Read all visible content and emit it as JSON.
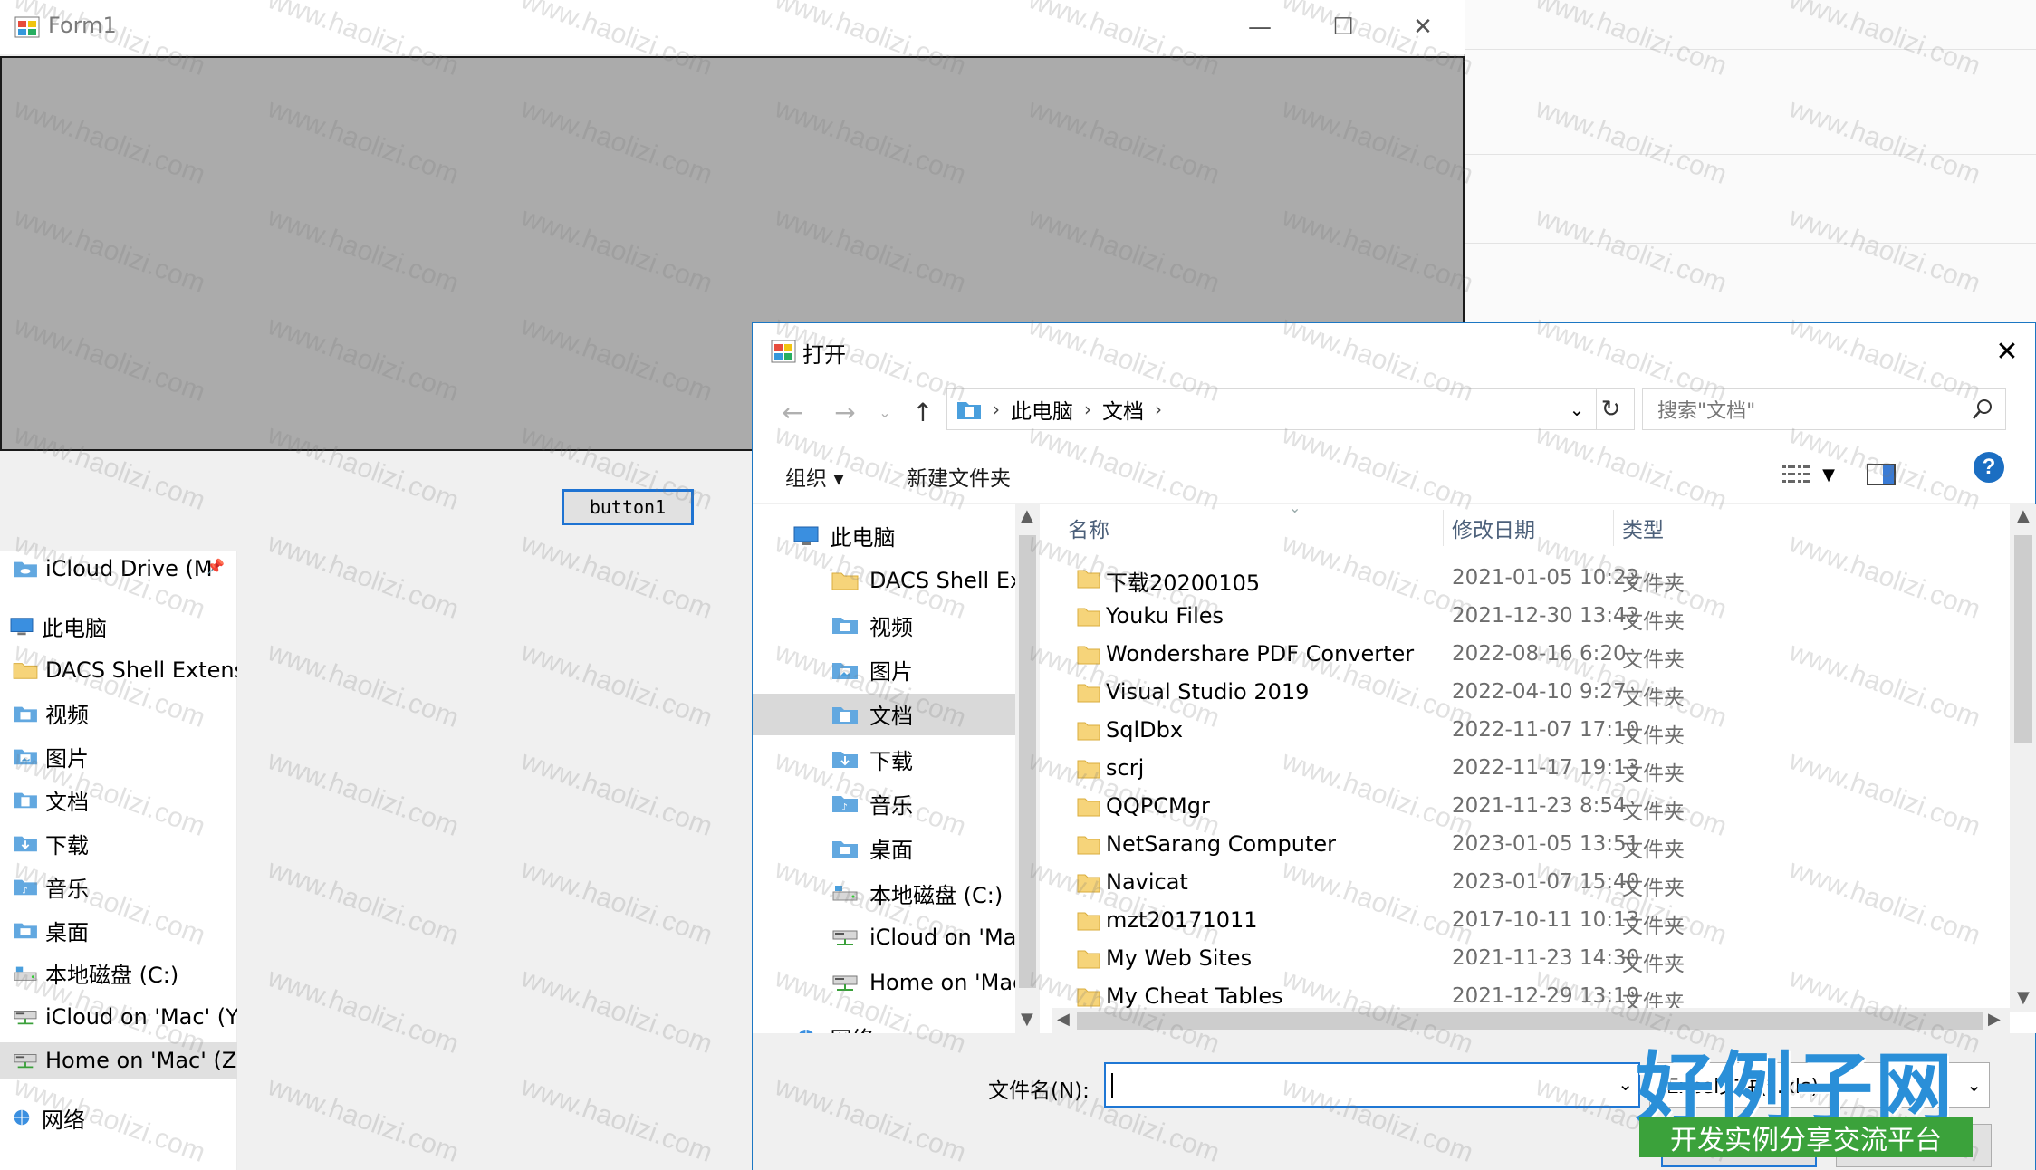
{
  "form1": {
    "title": "Form1",
    "button_label": "button1",
    "caption_buttons": {
      "minimize": "—",
      "maximize": "☐",
      "close": "✕"
    }
  },
  "background_nav": {
    "items": [
      {
        "label": "iCloud Drive (M",
        "icon": "cloud-folder-icon"
      },
      {
        "label": "此电脑",
        "icon": "computer-icon"
      },
      {
        "label": "DACS Shell Extensi",
        "icon": "folder-icon"
      },
      {
        "label": "视频",
        "icon": "video-folder-icon"
      },
      {
        "label": "图片",
        "icon": "pictures-folder-icon"
      },
      {
        "label": "文档",
        "icon": "documents-folder-icon"
      },
      {
        "label": "下载",
        "icon": "downloads-folder-icon"
      },
      {
        "label": "音乐",
        "icon": "music-folder-icon"
      },
      {
        "label": "桌面",
        "icon": "desktop-folder-icon"
      },
      {
        "label": "本地磁盘 (C:)",
        "icon": "drive-icon"
      },
      {
        "label": "iCloud on 'Mac' (Y:",
        "icon": "network-drive-icon"
      },
      {
        "label": "Home on 'Mac' (Z:",
        "icon": "network-drive-icon"
      },
      {
        "label": "网络",
        "icon": "network-icon"
      }
    ]
  },
  "dialog": {
    "title": "打开",
    "close": "✕",
    "breadcrumb": [
      "此电脑",
      "文档"
    ],
    "search_placeholder": "搜索\"文档\"",
    "organize": "组织 ▾",
    "new_folder": "新建文件夹",
    "help": "?",
    "nav_items": [
      {
        "label": "此电脑",
        "icon": "computer-icon"
      },
      {
        "label": "DACS Shell Exte",
        "icon": "folder-icon"
      },
      {
        "label": "视频",
        "icon": "video-folder-icon"
      },
      {
        "label": "图片",
        "icon": "pictures-folder-icon"
      },
      {
        "label": "文档",
        "icon": "documents-folder-icon",
        "selected": true
      },
      {
        "label": "下载",
        "icon": "downloads-folder-icon"
      },
      {
        "label": "音乐",
        "icon": "music-folder-icon"
      },
      {
        "label": "桌面",
        "icon": "desktop-folder-icon"
      },
      {
        "label": "本地磁盘 (C:)",
        "icon": "drive-icon"
      },
      {
        "label": "iCloud on 'Mac",
        "icon": "network-drive-icon"
      },
      {
        "label": "Home on 'Mac",
        "icon": "network-drive-icon"
      },
      {
        "label": "网络",
        "icon": "network-icon"
      }
    ],
    "columns": {
      "name": "名称",
      "date": "修改日期",
      "type": "类型"
    },
    "files": [
      {
        "name": "下载20200105",
        "date": "2021-01-05 10:22",
        "type": "文件夹"
      },
      {
        "name": "Youku Files",
        "date": "2021-12-30 13:42",
        "type": "文件夹"
      },
      {
        "name": "Wondershare PDF Converter",
        "date": "2022-08-16 6:20",
        "type": "文件夹"
      },
      {
        "name": "Visual Studio 2019",
        "date": "2022-04-10 9:27",
        "type": "文件夹"
      },
      {
        "name": "SqlDbx",
        "date": "2022-11-07 17:10",
        "type": "文件夹"
      },
      {
        "name": "scrj",
        "date": "2022-11-17 19:13",
        "type": "文件夹"
      },
      {
        "name": "QQPCMgr",
        "date": "2021-11-23 8:54",
        "type": "文件夹"
      },
      {
        "name": "NetSarang Computer",
        "date": "2023-01-05 13:51",
        "type": "文件夹"
      },
      {
        "name": "Navicat",
        "date": "2023-01-07 15:40",
        "type": "文件夹"
      },
      {
        "name": "mzt20171011",
        "date": "2017-10-11 10:13",
        "type": "文件夹"
      },
      {
        "name": "My Web Sites",
        "date": "2021-11-23 14:30",
        "type": "文件夹"
      },
      {
        "name": "My Cheat Tables",
        "date": "2021-12-29 13:19",
        "type": "文件夹"
      }
    ],
    "filename_label": "文件名(N):",
    "filename_value": "",
    "filter_value": "Excel文件(*.xls)"
  },
  "watermark": {
    "text": "www.haolizi.com",
    "brand": "好例子网",
    "brand_tagline": "开发实例分享交流平台"
  },
  "colors": {
    "accent": "#1e73d2",
    "panel_gray": "#ababab",
    "folder": "#f6d47a",
    "selection": "#d9d9d9"
  }
}
